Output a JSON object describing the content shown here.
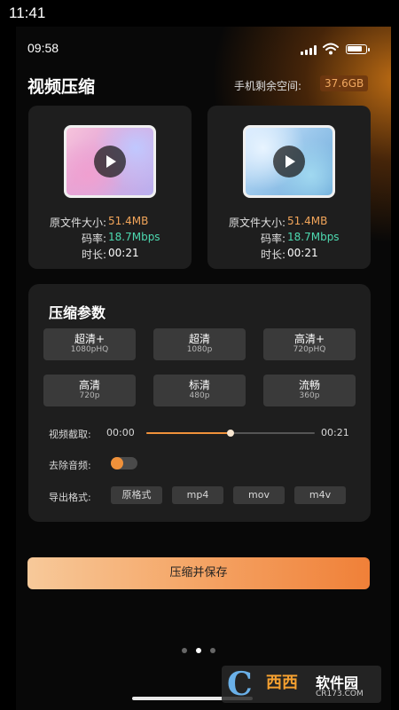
{
  "device": {
    "time": "11:41"
  },
  "app": {
    "status_time": "09:58",
    "battery_level": 0.85,
    "title": "视频压缩",
    "storage_label": "手机剩余空间:",
    "storage_value": "37.6GB",
    "videos": [
      {
        "thumbnail": "pink-gradient",
        "size_label": "原文件大小:",
        "size_value": "51.4MB",
        "bitrate_label": "码率:",
        "bitrate_value": "18.7Mbps",
        "duration_label": "时长:",
        "duration_value": "00:21"
      },
      {
        "thumbnail": "blue-gradient",
        "size_label": "原文件大小:",
        "size_value": "51.4MB",
        "bitrate_label": "码率:",
        "bitrate_value": "18.7Mbps",
        "duration_label": "时长:",
        "duration_value": "00:21"
      }
    ],
    "params": {
      "title": "压缩参数",
      "presets": [
        {
          "name": "超清+",
          "res": "1080pHQ"
        },
        {
          "name": "超清",
          "res": "1080p"
        },
        {
          "name": "高清+",
          "res": "720pHQ"
        },
        {
          "name": "高清",
          "res": "720p"
        },
        {
          "name": "标清",
          "res": "480p"
        },
        {
          "name": "流畅",
          "res": "360p"
        }
      ],
      "trim_label": "视频截取:",
      "trim_start": "00:00",
      "trim_end": "00:21",
      "trim_end_fraction": 0.5,
      "mute_label": "去除音频:",
      "mute_enabled": false,
      "format_label": "导出格式:",
      "formats": [
        "原格式",
        "mp4",
        "mov",
        "m4v"
      ]
    },
    "save_button": "压缩并保存",
    "pager": {
      "count": 3,
      "active": 1
    }
  },
  "watermark": {
    "logo": "C",
    "brand": "西西",
    "brand2": "软件园",
    "url": "CR173.COM"
  },
  "colors": {
    "accent": "#f0913a",
    "orange_value": "#f2a55a",
    "teal_value": "#4dd9b0",
    "card_bg": "#1e1e1e",
    "chip_bg": "#3a3a3a"
  }
}
